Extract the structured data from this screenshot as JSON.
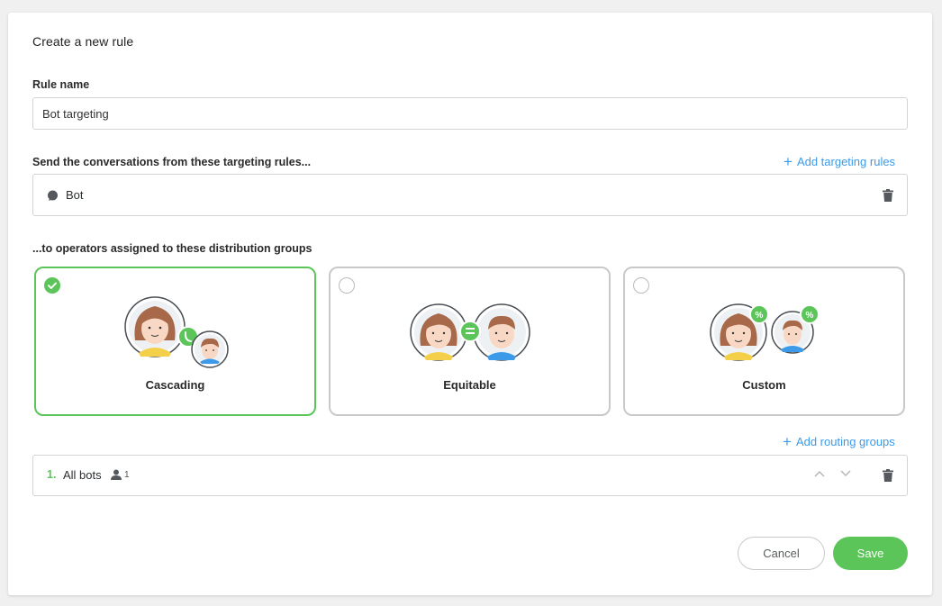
{
  "form": {
    "title": "Create a new rule",
    "rule_name_label": "Rule name",
    "rule_name_value": "Bot targeting",
    "targeting_label": "Send the conversations from these targeting rules...",
    "add_targeting_label": "Add targeting rules",
    "targeting_rules": [
      {
        "icon": "chat-bubble-icon",
        "label": "Bot"
      }
    ],
    "distribution_label": "...to operators assigned to these distribution groups",
    "distribution_options": [
      {
        "label": "Cascading",
        "selected": true
      },
      {
        "label": "Equitable",
        "selected": false
      },
      {
        "label": "Custom",
        "selected": false
      }
    ],
    "add_routing_label": "Add routing groups",
    "routing_groups": [
      {
        "number": "1.",
        "name": "All bots",
        "count": "1"
      }
    ],
    "cancel_label": "Cancel",
    "save_label": "Save"
  },
  "colors": {
    "accent_green": "#5cc55a",
    "link_blue": "#3d9ae8",
    "border": "#d2d4d6"
  }
}
